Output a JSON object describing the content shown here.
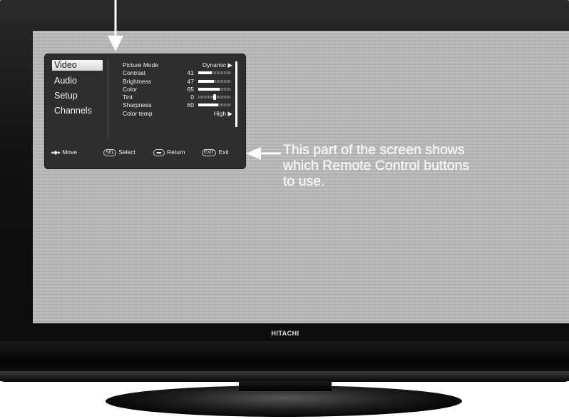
{
  "tv": {
    "brand": "HITACHI"
  },
  "menu": {
    "categories": [
      "Video",
      "Audio",
      "Setup",
      "Channels"
    ],
    "active_category": "Video",
    "items": [
      {
        "label": "Picture Mode",
        "value": "Dynamic ▶"
      },
      {
        "label": "Contrast",
        "value": "41",
        "level_pct": 41
      },
      {
        "label": "Brightness",
        "value": "47",
        "level_pct": 47
      },
      {
        "label": "Color",
        "value": "65",
        "level_pct": 65
      },
      {
        "label": "Tint",
        "value": "0",
        "tint_marker": "G"
      },
      {
        "label": "Sharpness",
        "value": "60",
        "level_pct": 60
      },
      {
        "label": "Color temp",
        "value": "High ▶"
      }
    ],
    "footer": {
      "move": "Move",
      "select_key": "SEL",
      "select": "Select",
      "return": "Return",
      "exit_key": "EXIT",
      "exit": "Exit"
    }
  },
  "annotation": {
    "lines": [
      "This part of the screen shows",
      "which Remote Control buttons",
      "to use."
    ]
  },
  "colors": {
    "screen": "#bdbdbd",
    "menu_bg": "#2e2e2e",
    "arrow": "#ffffff"
  },
  "icons": {
    "arrow_down": "down-arrow-icon",
    "arrow_left": "left-arrow-icon",
    "move": "four-way-arrow-icon"
  }
}
